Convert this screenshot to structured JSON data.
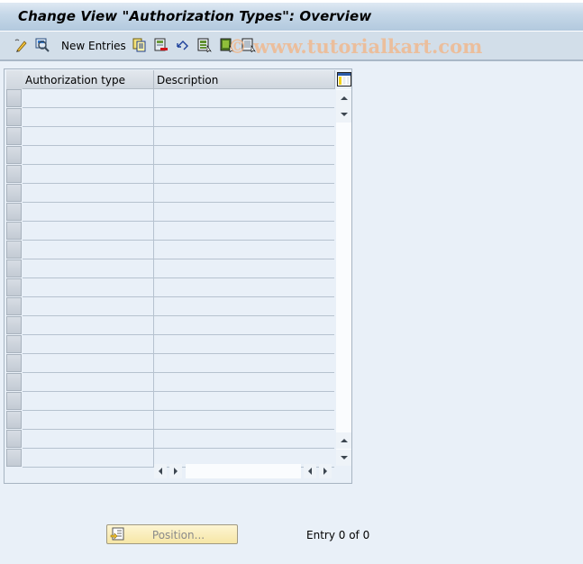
{
  "window": {
    "title": "Change View \"Authorization Types\": Overview"
  },
  "toolbar": {
    "items": [
      {
        "type": "icon",
        "icon": "display-change-icon",
        "label": "Display -> Change"
      },
      {
        "type": "icon",
        "icon": "where-used-icon",
        "label": "Details"
      },
      {
        "type": "text",
        "label": "New Entries"
      },
      {
        "type": "icon",
        "icon": "copy-as-icon",
        "label": "Copy As..."
      },
      {
        "type": "icon",
        "icon": "delete-icon",
        "label": "Delete"
      },
      {
        "type": "icon",
        "icon": "undo-change-icon",
        "label": "Undo Change"
      },
      {
        "type": "icon",
        "icon": "select-all-icon",
        "label": "Select All"
      },
      {
        "type": "icon",
        "icon": "select-block-icon",
        "label": "Select Block"
      },
      {
        "type": "icon",
        "icon": "deselect-all-icon",
        "label": "Deselect All"
      }
    ],
    "new_entries_label": "New Entries"
  },
  "watermark": "© www.tutorialkart.com",
  "table": {
    "columns": [
      {
        "key": "auth_type",
        "label": "Authorization type"
      },
      {
        "key": "description",
        "label": "Description"
      }
    ],
    "rows_visible": 20,
    "rows": []
  },
  "footer": {
    "position_button": "Position...",
    "entry_info": "Entry 0 of 0"
  }
}
